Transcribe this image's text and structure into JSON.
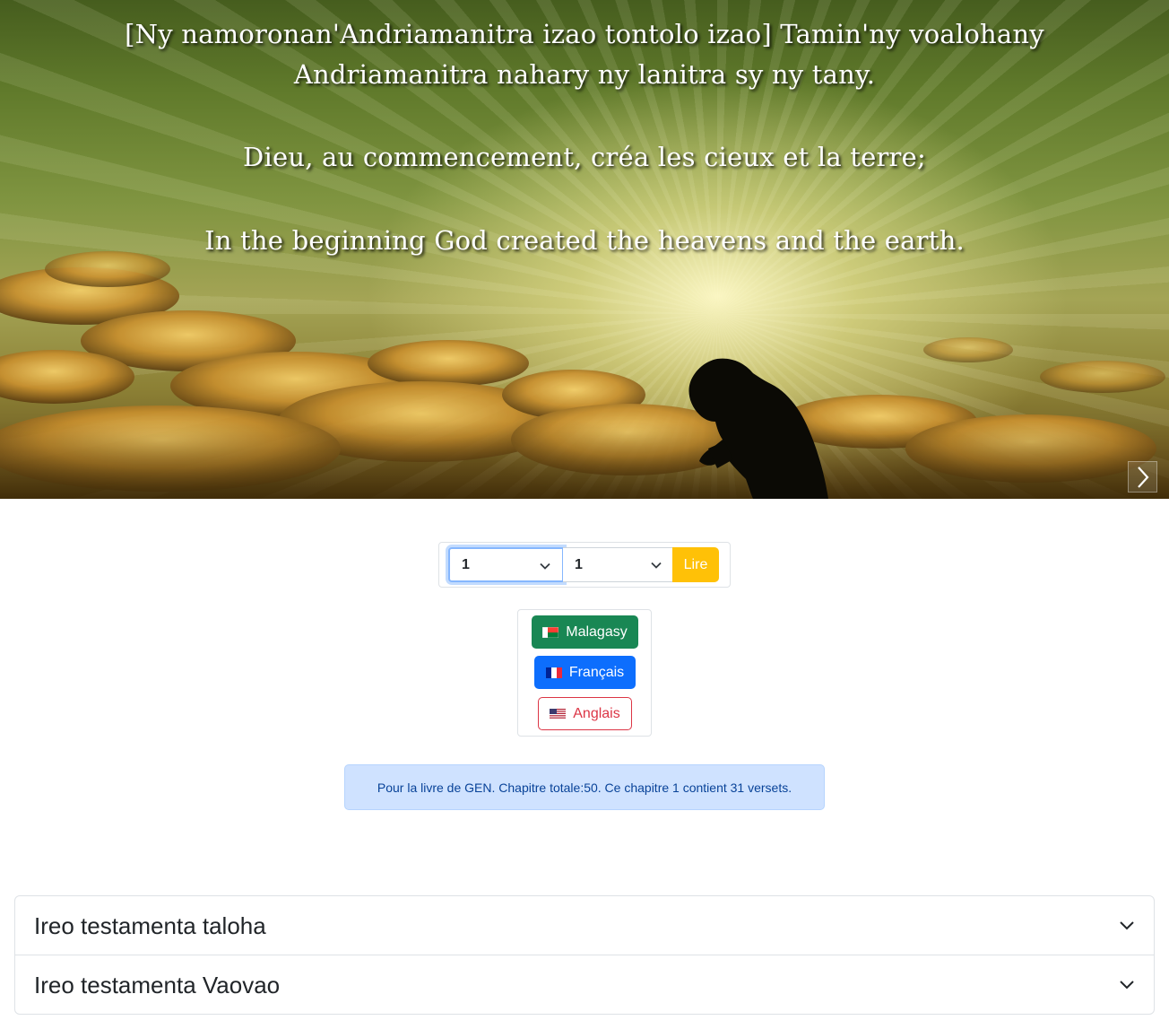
{
  "hero": {
    "verse_malagasy_line1": "[Ny namoronan'Andriamanitra izao tontolo izao] Tamin'ny voalohany",
    "verse_malagasy_line2": "Andriamanitra nahary ny lanitra sy ny tany.",
    "verse_french": "Dieu, au commencement, créa les cieux et la terre;",
    "verse_english": "In the beginning God created the heavens and the earth.",
    "next_icon": "chevron-right-icon"
  },
  "selector": {
    "book_value": "1",
    "chapter_value": "1",
    "read_label": "Lire"
  },
  "languages": {
    "malagasy_label": "Malagasy",
    "french_label": "Français",
    "english_label": "Anglais"
  },
  "info": {
    "text": "Pour la livre de GEN. Chapitre totale:50. Ce chapitre 1 contient 31 versets."
  },
  "accordion": {
    "old_testament": "Ireo testamenta taloha",
    "new_testament": "Ireo testamenta Vaovao"
  },
  "colors": {
    "success": "#198754",
    "primary": "#0d6efd",
    "danger": "#dc3545",
    "warning": "#ffc107",
    "info_bg": "#cfe2ff",
    "info_text": "#084298"
  }
}
